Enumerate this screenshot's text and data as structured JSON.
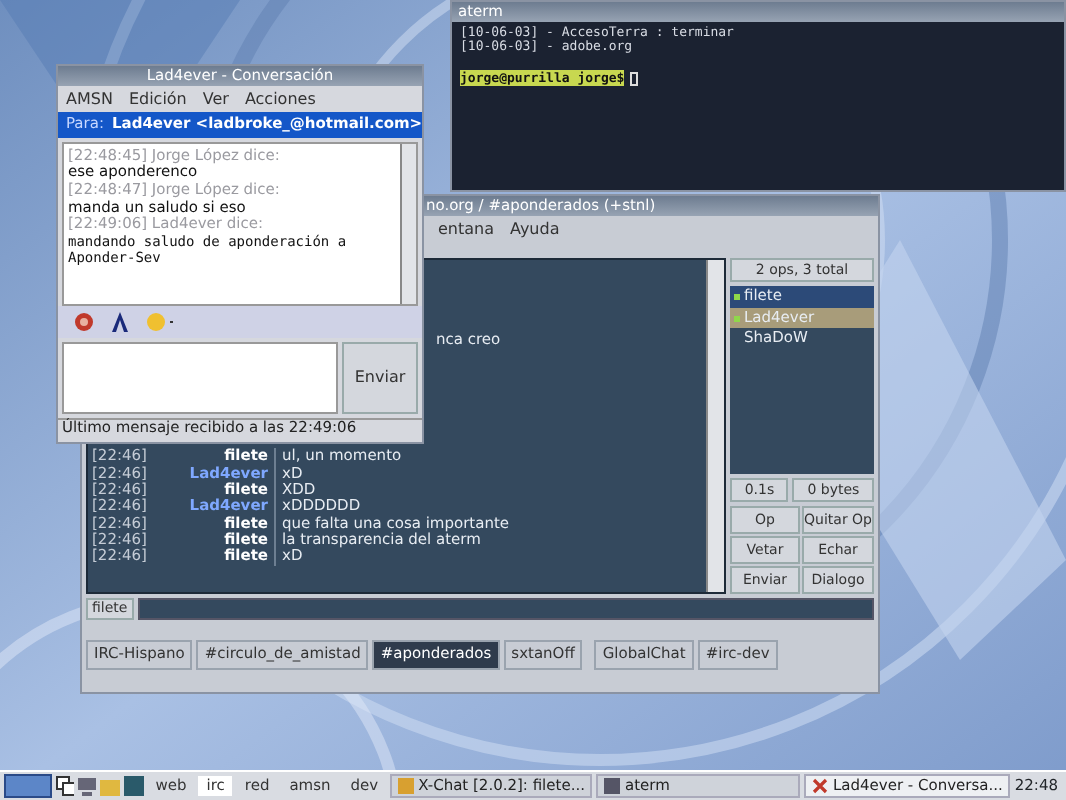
{
  "terminal": {
    "title": "aterm",
    "lines": [
      "[10-06-03] - AccesoTerra : terminar",
      "[10-06-03] - adobe.org"
    ],
    "prompt": "jorge@purrilla jorge$"
  },
  "xchat": {
    "title": "no.org / #aponderados (+stnl)",
    "menu": [
      "entana",
      "Ayuda"
    ],
    "partial_line": "nca creo",
    "messages": [
      {
        "time": "[22:46]",
        "nick": "filete",
        "text": "ul, un momento",
        "color": "#ffffff"
      },
      {
        "time": "[22:46]",
        "nick": "Lad4ever",
        "text": "xD",
        "color": "#7fa8ff"
      },
      {
        "time": "[22:46]",
        "nick": "filete",
        "text": "XDD",
        "color": "#ffffff"
      },
      {
        "time": "[22:46]",
        "nick": "Lad4ever",
        "text": "xDDDDDD",
        "color": "#7fa8ff"
      },
      {
        "time": "[22:46]",
        "nick": "filete",
        "text": "que falta una cosa importante",
        "color": "#ffffff"
      },
      {
        "time": "[22:46]",
        "nick": "filete",
        "text": "la transparencia del aterm",
        "color": "#ffffff"
      },
      {
        "time": "[22:46]",
        "nick": "filete",
        "text": "xD",
        "color": "#ffffff"
      }
    ],
    "input_nick": "filete",
    "tabs": [
      {
        "label": "IRC-Hispano",
        "selected": false
      },
      {
        "label": "#circulo_de_amistad",
        "selected": false
      },
      {
        "label": "#aponderados",
        "selected": true
      },
      {
        "label": "sxtanOff",
        "selected": false
      },
      {
        "label": "GlobalChat",
        "selected": false
      },
      {
        "label": "#irc-dev",
        "selected": false
      }
    ],
    "user_count": "2 ops, 3 total",
    "users": [
      {
        "name": "filete",
        "op": true,
        "selected": false
      },
      {
        "name": "Lad4ever",
        "op": true,
        "selected": true
      },
      {
        "name": "ShaDoW",
        "op": false,
        "selected": false
      }
    ],
    "lag": "0.1s",
    "bytes": "0 bytes",
    "buttons": [
      "Op",
      "Quitar Op",
      "Vetar",
      "Echar",
      "Enviar",
      "Dialogo"
    ]
  },
  "amsn": {
    "title": "Lad4ever - Conversación",
    "menu": [
      "AMSN",
      "Edición",
      "Ver",
      "Acciones"
    ],
    "to_label": "Para:",
    "to": "Lad4ever <ladbroke_@hotmail.com>",
    "messages": [
      {
        "header": "[22:48:45] Jorge López dice:",
        "text": "ese aponderenco",
        "kind": "plain"
      },
      {
        "header": "[22:48:47] Jorge López dice:",
        "text": "manda un saludo si eso",
        "kind": "plain"
      },
      {
        "header": "[22:49:06] Lad4ever dice:",
        "text": "mandando saludo de aponderación a Aponder-Sev",
        "kind": "mono"
      }
    ],
    "send": "Enviar",
    "status": "Último mensaje recibido a las 22:49:06"
  },
  "taskbar": {
    "desktops": [
      {
        "label": "web",
        "selected": false
      },
      {
        "label": "irc",
        "selected": true
      },
      {
        "label": "red",
        "selected": false
      },
      {
        "label": "amsn",
        "selected": false
      },
      {
        "label": "dev",
        "selected": false
      }
    ],
    "tasks": [
      {
        "label": "X-Chat [2.0.2]: filete...",
        "kind": "xchat",
        "active": false
      },
      {
        "label": "aterm",
        "kind": "term",
        "active": false
      },
      {
        "label": "Lad4ever - Conversa...",
        "kind": "amsn",
        "active": true
      }
    ],
    "clock": "22:48"
  }
}
